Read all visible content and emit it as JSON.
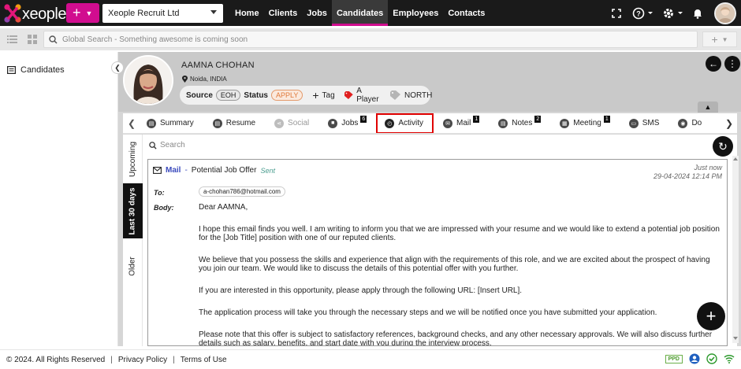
{
  "topbar": {
    "logo_text": "xeople",
    "company": "Xeople Recruit Ltd",
    "nav": [
      {
        "label": "Home"
      },
      {
        "label": "Clients"
      },
      {
        "label": "Jobs"
      },
      {
        "label": "Candidates",
        "active": true
      },
      {
        "label": "Employees"
      },
      {
        "label": "Contacts"
      }
    ],
    "icons": [
      "expand-icon",
      "help-icon",
      "settings-icon",
      "bell-icon",
      "user-avatar"
    ]
  },
  "subbar": {
    "search_placeholder": "Global Search - Something awesome is coming soon"
  },
  "sidebar": {
    "item_label": "Candidates"
  },
  "candidate": {
    "name": "AAMNA CHOHAN",
    "location": "Noida, INDIA",
    "source_label": "Source",
    "source_value": "EOH",
    "status_label": "Status",
    "status_value": "APPLY",
    "tag_label": "Tag",
    "player_label": "A Player",
    "region_label": "NORTH"
  },
  "tabs": [
    {
      "label": "Summary"
    },
    {
      "label": "Resume"
    },
    {
      "label": "Social",
      "disabled": true
    },
    {
      "label": "Jobs",
      "badge": "6"
    },
    {
      "label": "Activity",
      "active": true
    },
    {
      "label": "Mail",
      "badge": "1"
    },
    {
      "label": "Notes",
      "badge": "2"
    },
    {
      "label": "Meeting",
      "badge": "1"
    },
    {
      "label": "SMS"
    },
    {
      "label": "Do"
    }
  ],
  "vertical_tabs": [
    {
      "label": "Upcoming"
    },
    {
      "label": "Last 30 days",
      "active": true
    },
    {
      "label": "Older"
    }
  ],
  "activity_search_placeholder": "Search",
  "mail": {
    "type": "Mail",
    "dash": "-",
    "subject": "Potential Job Offer",
    "sent_label": "Sent",
    "time_relative": "Just now",
    "time_absolute": "29-04-2024 12:14 PM",
    "to_label": "To:",
    "to_value": "a-chohan786@hotmail.com",
    "body_label": "Body:",
    "body_paragraphs": [
      "Dear AAMNA,",
      "I hope this email finds you well. I am writing to inform you that we are impressed with your resume and we would like to extend a potential job position for the [Job Title] position with one of our reputed clients.",
      "We believe that you possess the skills and experience that align with the requirements of this role, and we are excited about the prospect of having you join our team. We would like to discuss the details of this potential offer with you further.",
      "If you are interested in this opportunity, please apply through the following URL: [Insert URL].",
      "The application process will take you through the necessary steps and we will be notified once you have submitted your application.",
      "Please note that this offer is subject to satisfactory references, background checks, and any other necessary approvals. We will also discuss further details such as salary, benefits, and start date with you during the interview process."
    ]
  },
  "footer": {
    "copyright": "© 2024. All Rights Reserved",
    "privacy": "Privacy Policy",
    "terms": "Terms of Use",
    "ppd": "PPD"
  },
  "colors": {
    "brand": "#d10d8f",
    "topbar": "#1a1a1a",
    "active_tab_border": "#e00000",
    "mail_link": "#3b4bbd",
    "status_apply": "#e07a3c"
  }
}
